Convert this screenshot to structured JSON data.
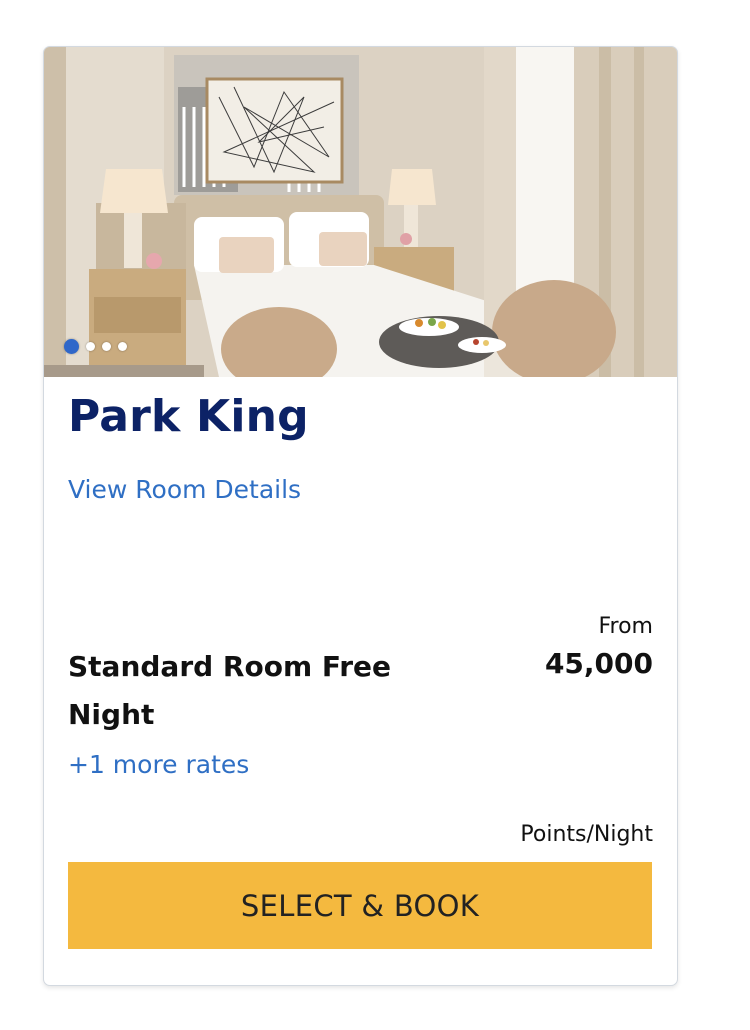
{
  "room": {
    "name": "Park King",
    "details_link": "View Room Details",
    "image_alt": "hotel-room-photo",
    "carousel": {
      "total_slides": 4,
      "active_slide": 1
    }
  },
  "rate": {
    "name": "Standard Room Free Night",
    "from_label": "From",
    "price": "45,000",
    "unit_label": "Points/Night",
    "more_rates": "+1 more rates"
  },
  "actions": {
    "book_label": "SELECT & BOOK"
  },
  "colors": {
    "title": "#0c2266",
    "link": "#2f6fc4",
    "button": "#f4b93f",
    "active_dot": "#2f67c9"
  }
}
